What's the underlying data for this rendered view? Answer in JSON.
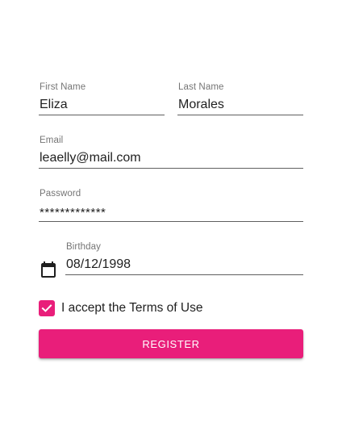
{
  "form": {
    "first_name": {
      "label": "First Name",
      "value": "Eliza"
    },
    "last_name": {
      "label": "Last Name",
      "value": "Morales"
    },
    "email": {
      "label": "Email",
      "value": "leaelly@mail.com"
    },
    "password": {
      "label": "Password",
      "value": "*************"
    },
    "birthday": {
      "label": "Birthday",
      "value": "08/12/1998",
      "icon": "calendar-icon"
    },
    "terms": {
      "label": "I accept the Terms of Use",
      "checked": true
    },
    "register_label": "REGISTER"
  },
  "colors": {
    "accent": "#e91e7a",
    "underline": "#5f5f5f",
    "label": "#757575"
  }
}
